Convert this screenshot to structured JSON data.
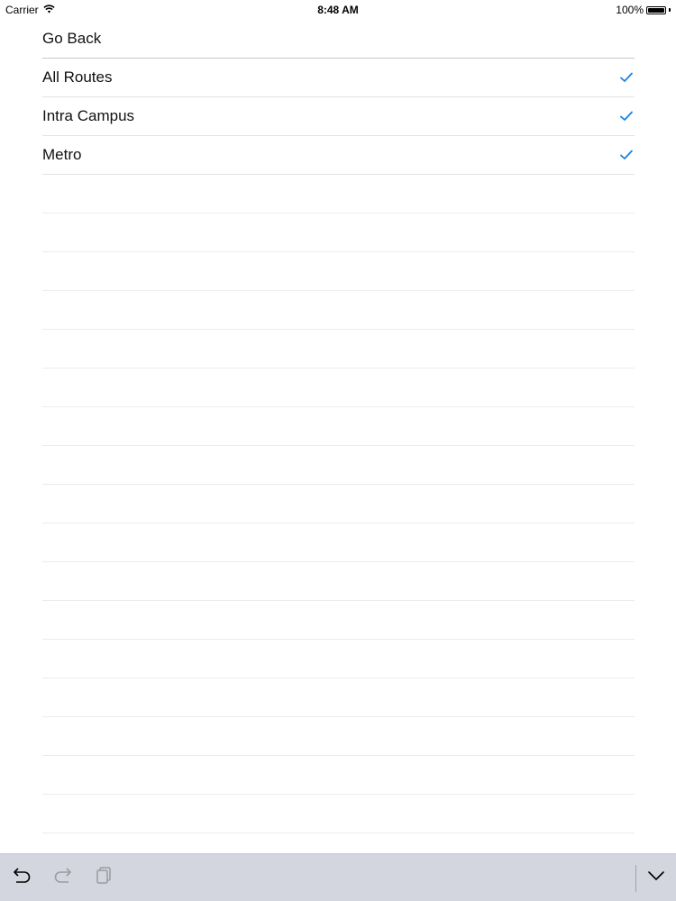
{
  "status_bar": {
    "carrier": "Carrier",
    "time": "8:48 AM",
    "battery": "100%",
    "wifi_icon": "wifi-icon",
    "battery_icon": "battery-icon"
  },
  "list": {
    "go_back": "Go Back",
    "items": [
      {
        "label": "All Routes",
        "checked": true
      },
      {
        "label": "Intra Campus",
        "checked": true
      },
      {
        "label": "Metro",
        "checked": true
      }
    ],
    "empty_rows": 17
  },
  "toolbar": {
    "undo_icon": "undo-icon",
    "redo_icon": "redo-icon",
    "paste_icon": "clipboard-icon",
    "dismiss_icon": "chevron-down-icon"
  },
  "colors": {
    "accent": "#1a82e2",
    "toolbar_bg": "#d3d6de",
    "separator": "#e3e3e6"
  }
}
